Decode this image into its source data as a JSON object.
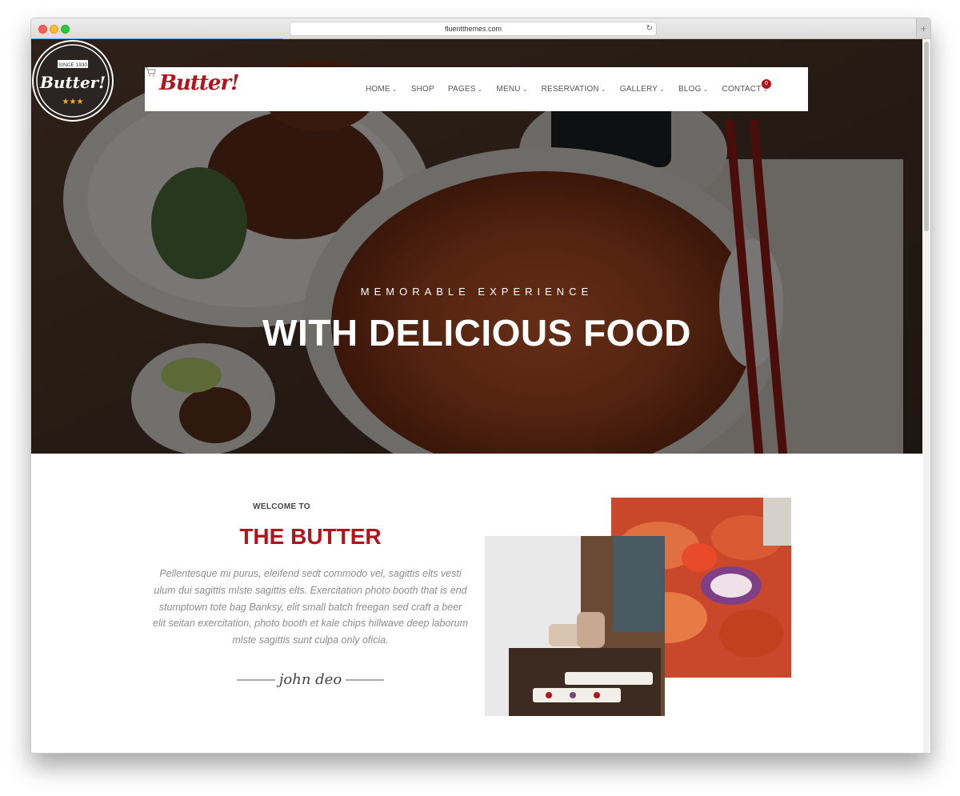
{
  "browser": {
    "url": "fluentthemes.com",
    "reload_icon": "reload-icon",
    "new_tab_icon": "plus-icon"
  },
  "brand": {
    "logo_text": "Butter!",
    "accent_color": "#b3141c"
  },
  "nav": {
    "items": [
      {
        "label": "HOME",
        "dropdown": true
      },
      {
        "label": "SHOP",
        "dropdown": false
      },
      {
        "label": "PAGES",
        "dropdown": true
      },
      {
        "label": "MENU",
        "dropdown": true
      },
      {
        "label": "RESERVATION",
        "dropdown": true
      },
      {
        "label": "GALLERY",
        "dropdown": true
      },
      {
        "label": "BLOG",
        "dropdown": true
      },
      {
        "label": "CONTACT",
        "dropdown": true
      }
    ],
    "cart_icon": "cart-icon",
    "cart_count": "0"
  },
  "hero": {
    "seal_top": "SINCE 1930",
    "seal_name": "Butter!",
    "seal_stars": "★★★",
    "tagline": "MEMORABLE EXPERIENCE",
    "headline": "WITH DELICIOUS FOOD"
  },
  "welcome": {
    "kicker": "WELCOME TO",
    "title": "THE BUTTER",
    "body": "Pellentesque mi purus, eleifend sedt commodo vel, sagittis elts vesti ulum dui sagittis mlste sagittis elts. Exercitation photo booth that is end stumptown tote bag Banksy, elit small batch freegan sed craft a beer elit seitan exercitation, photo booth et kale chips hillwave deep laborum mlste sagittis sunt culpa only oficia.",
    "signature": "john deo"
  }
}
